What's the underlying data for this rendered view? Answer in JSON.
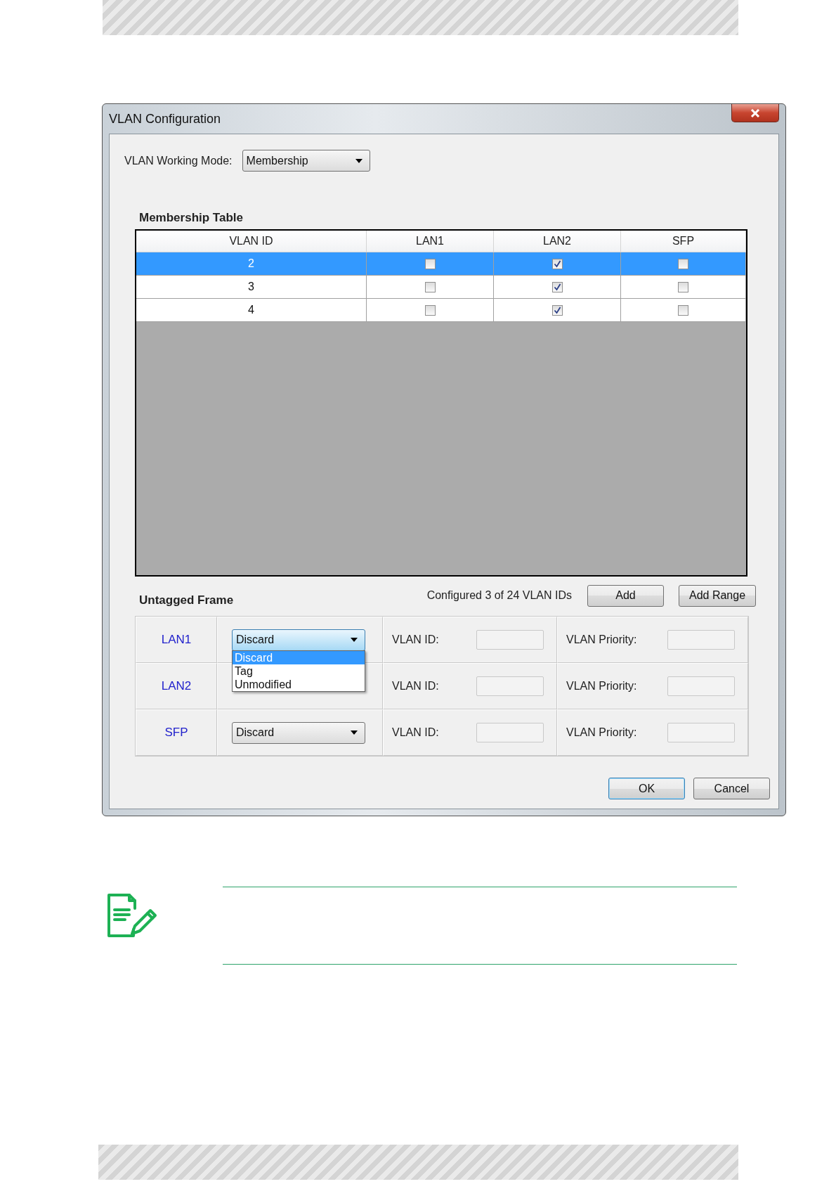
{
  "window": {
    "title": "VLAN Configuration"
  },
  "working_mode": {
    "label": "VLAN Working Mode:",
    "value": "Membership"
  },
  "membership_table": {
    "title": "Membership Table",
    "columns": [
      "VLAN ID",
      "LAN1",
      "LAN2",
      "SFP"
    ],
    "rows": [
      {
        "vlan_id": "2",
        "selected": true,
        "lan1": false,
        "lan2": true,
        "sfp": false
      },
      {
        "vlan_id": "3",
        "selected": false,
        "lan1": false,
        "lan2": true,
        "sfp": false
      },
      {
        "vlan_id": "4",
        "selected": false,
        "lan1": false,
        "lan2": true,
        "sfp": false
      }
    ]
  },
  "untagged_frame": {
    "title": "Untagged Frame",
    "status": "Configured 3 of 24 VLAN IDs",
    "buttons": [
      "Add",
      "Add Range"
    ],
    "ports": [
      {
        "name": "LAN1",
        "mode": "Discard",
        "expanded": true,
        "options": [
          {
            "label": "Discard",
            "selected": true
          },
          {
            "label": "Tag",
            "selected": false
          },
          {
            "label": "Unmodified",
            "selected": false
          }
        ],
        "vlan_id_label": "VLAN ID:",
        "priority_label": "VLAN Priority:"
      },
      {
        "name": "LAN2",
        "vlan_id_label": "VLAN ID:",
        "priority_label": "VLAN Priority:"
      },
      {
        "name": "SFP",
        "mode": "Discard",
        "expanded": false,
        "vlan_id_label": "VLAN ID:",
        "priority_label": "VLAN Priority:"
      }
    ]
  },
  "buttons": [
    {
      "label": "OK",
      "kind": "default"
    },
    {
      "label": "Cancel",
      "kind": "normal"
    }
  ]
}
